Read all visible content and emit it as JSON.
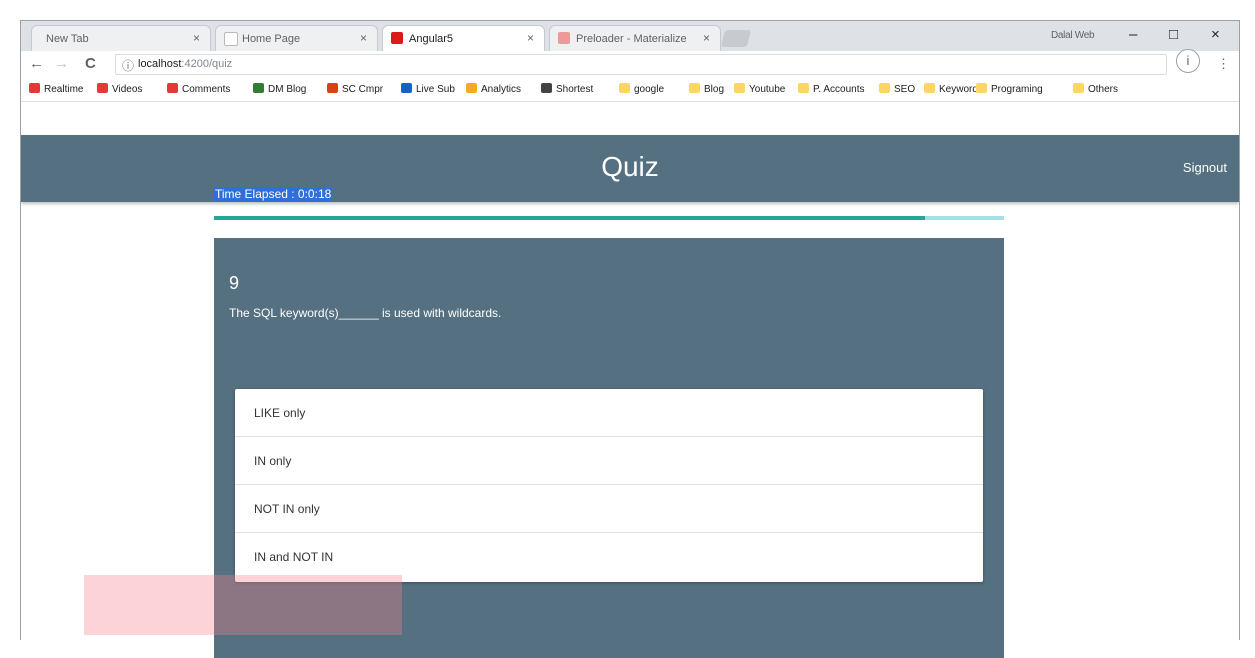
{
  "browser": {
    "tabs": [
      {
        "title": "New Tab",
        "active": false
      },
      {
        "title": "Home Page",
        "active": false
      },
      {
        "title": "Angular5",
        "active": true
      },
      {
        "title": "Preloader - Materialize",
        "active": false
      }
    ],
    "tab_close": "×",
    "profile_name": "Dalal Web",
    "window_buttons": {
      "minimize": "–",
      "maximize": "□",
      "close": "×"
    },
    "nav": {
      "back": "←",
      "forward": "→",
      "reload": "C"
    },
    "url": {
      "host": "localhost",
      "path": ":4200/quiz"
    },
    "info_icon": "ⓘ",
    "bookmarks": [
      {
        "label": "Realtime",
        "color": "#e53935"
      },
      {
        "label": "Videos",
        "color": "#e53935"
      },
      {
        "label": "Comments",
        "color": "#e53935"
      },
      {
        "label": "DM Blog",
        "color": "#2e7d32"
      },
      {
        "label": "SC Cmpr",
        "color": "#d84315"
      },
      {
        "label": "Live Sub",
        "color": "#1565c0"
      },
      {
        "label": "Analytics",
        "color": "#f9a825"
      },
      {
        "label": "Shortest",
        "color": "#424242"
      },
      {
        "label": "google",
        "color": "#fdd663"
      },
      {
        "label": "Blog",
        "color": "#fdd663"
      },
      {
        "label": "Youtube",
        "color": "#fdd663"
      },
      {
        "label": "P. Accounts",
        "color": "#fdd663"
      },
      {
        "label": "SEO",
        "color": "#fdd663"
      },
      {
        "label": "Keywords",
        "color": "#fdd663"
      },
      {
        "label": "Programing",
        "color": "#fdd663"
      },
      {
        "label": "Others",
        "color": "#fdd663"
      }
    ]
  },
  "app": {
    "title": "Quiz",
    "signout": "Signout",
    "elapsed": "Time Elapsed : 0:0:18",
    "progress": 0.9,
    "question": {
      "number": "9",
      "text": "The SQL keyword(s)______ is used with wildcards.",
      "options": [
        "LIKE only",
        "IN only",
        "NOT IN only",
        "IN and NOT IN"
      ]
    }
  },
  "colors": {
    "header": "#557080",
    "progress": "#26a69a",
    "progress_track": "#a7dfe6"
  }
}
